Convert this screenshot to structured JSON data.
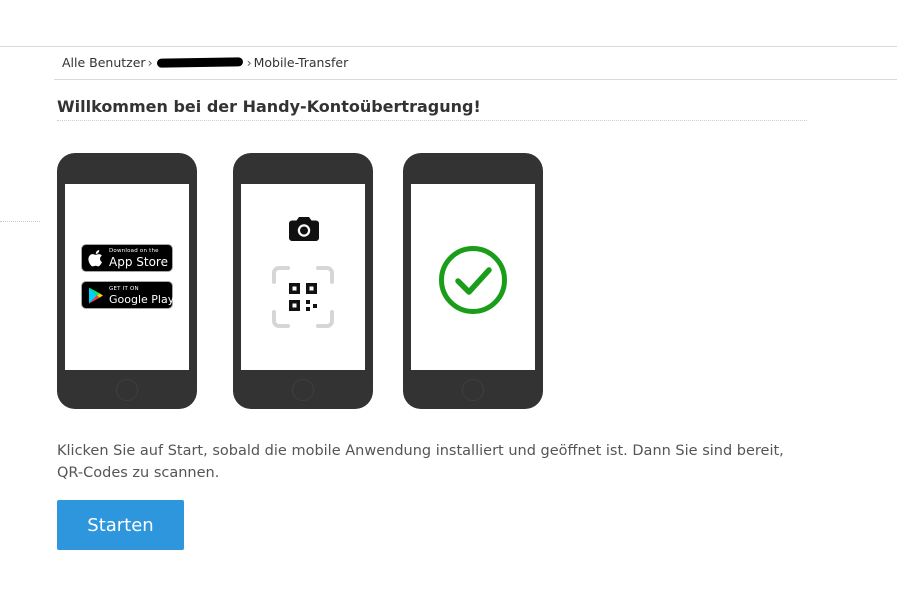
{
  "breadcrumb": {
    "root": "Alle Benutzer",
    "separator": "›",
    "current": "Mobile-Transfer"
  },
  "page": {
    "title": "Willkommen bei der Handy-Kontoübertragung!",
    "instructions": "Klicken Sie auf Start, sobald die mobile Anwendung installiert und geöffnet ist. Dann Sie sind bereit, QR-Codes zu scannen."
  },
  "steps": {
    "app_store": {
      "small": "Download on the",
      "big": "App Store"
    },
    "google_play": {
      "small": "GET IT ON",
      "big": "Google Play"
    },
    "scan_icons": [
      "camera-icon",
      "qr-code-icon"
    ],
    "done_icon": "check-circle-icon"
  },
  "actions": {
    "start_label": "Starten"
  },
  "colors": {
    "accent": "#2d96dd",
    "success": "#1a9e1a",
    "phone": "#333333",
    "text": "#333333"
  }
}
